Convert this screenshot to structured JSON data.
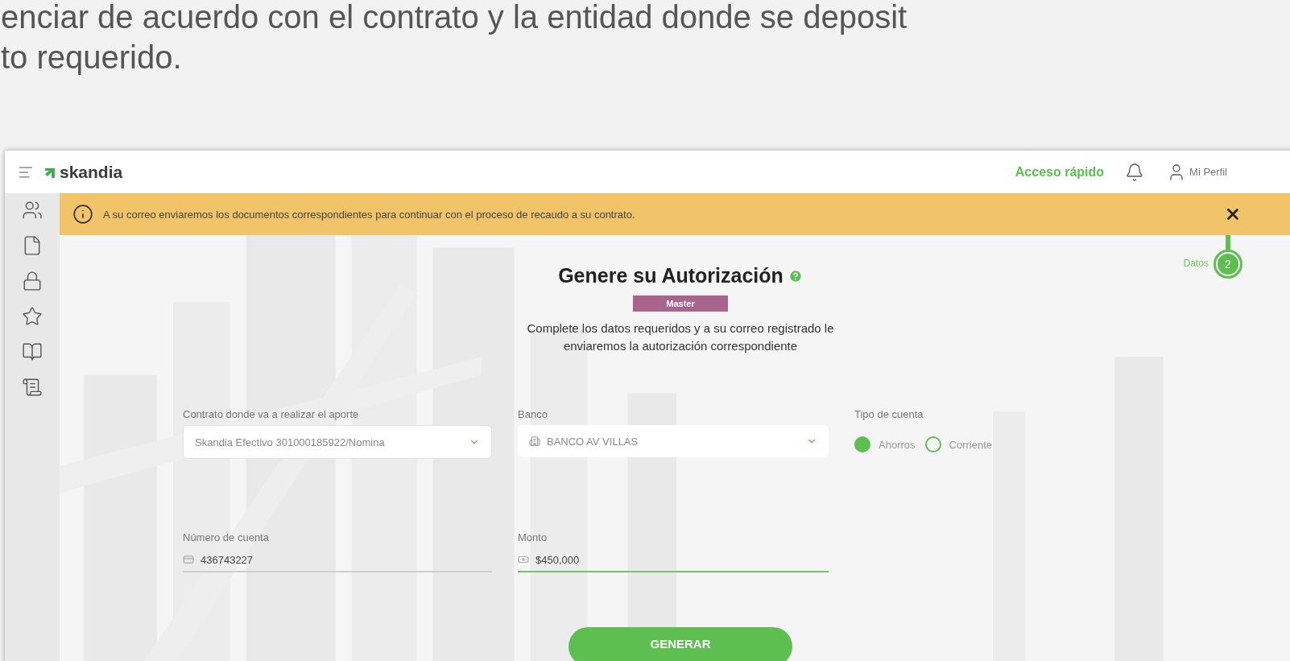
{
  "intro_text": [
    "enciar de acuerdo con el contrato y la entidad donde se deposit",
    "to requerido."
  ],
  "app": {
    "header": {
      "logo": "skandia",
      "quick_access": "Acceso rápido",
      "profile": "Mi Perfil"
    },
    "banner": {
      "message": "A su correo enviaremos los documentos correspondientes para continuar con el proceso de recaudo a su contrato."
    },
    "stepper": {
      "label": "Datos",
      "number": "2"
    },
    "form": {
      "title": "Genere su Autorización",
      "badge": "Master",
      "description": "Complete los datos requeridos y a su correo registrado le enviaremos la autorización correspondiente",
      "contract": {
        "label": "Contrato donde va a realizar el aporte",
        "value": "Skandia Efectivo 301000185922/Nomina"
      },
      "bank": {
        "label": "Banco",
        "value": "BANCO AV VILLAS"
      },
      "account_type": {
        "label": "Tipo de cuenta",
        "options": [
          {
            "label": "Ahorros",
            "selected": true
          },
          {
            "label": "Corriente",
            "selected": false
          }
        ]
      },
      "account_number": {
        "label": "Número de cuenta",
        "value": "436743227",
        "active": false
      },
      "amount": {
        "label": "Monto",
        "value": "$450,000",
        "active": true
      },
      "button": "GENERAR"
    }
  }
}
